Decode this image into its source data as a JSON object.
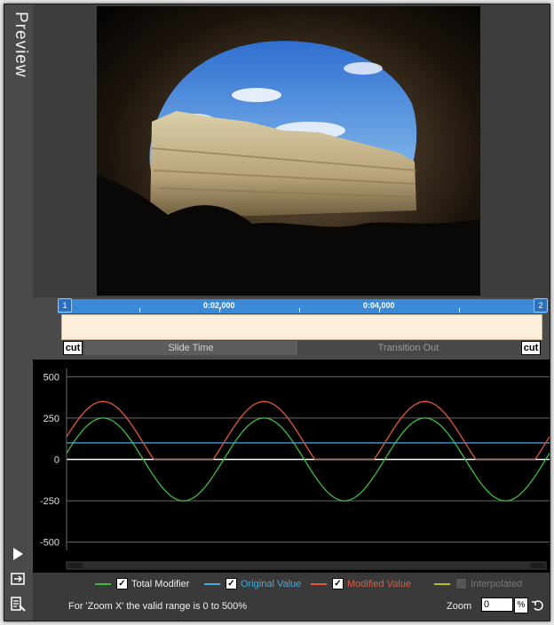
{
  "panel": {
    "title": "Preview"
  },
  "icons": {
    "play": "play-icon",
    "transition": "transition-icon",
    "edit": "edit-list-icon",
    "reset": "undo-icon"
  },
  "ruler": {
    "start_marker": "1",
    "end_marker": "2",
    "time_labels": [
      "0:02,000",
      "0:04,000"
    ],
    "cut_left": "cut",
    "cut_right": "cut",
    "segments": {
      "slide_time": "Slide Time",
      "transition_out": "Transition Out"
    }
  },
  "graph": {
    "y_ticks": [
      "500",
      "250",
      "0",
      "-250",
      "-500"
    ]
  },
  "chart_data": {
    "type": "line",
    "ylim": [
      -550,
      550
    ],
    "x_cycles": 3,
    "series": [
      {
        "name": "Total Modifier",
        "color": "#3fbf3f",
        "amplitude": 250,
        "offset": 0
      },
      {
        "name": "Original Value",
        "color": "#4aa8d8",
        "constant": 100
      },
      {
        "name": "Modified Value",
        "color": "#e05a3a",
        "amplitude": 250,
        "offset": 100,
        "floor": 0
      },
      {
        "name": "Interpolated",
        "color": "#b8c020"
      }
    ]
  },
  "legend": [
    {
      "label": "Total Modifier",
      "color": "#3fbf3f",
      "label_color": "#f0f0f0",
      "checked": true
    },
    {
      "label": "Original Value",
      "color": "#4aa8d8",
      "label_color": "#4aa8d8",
      "checked": true
    },
    {
      "label": "Modified Value",
      "color": "#e05a3a",
      "label_color": "#e05a3a",
      "checked": true
    },
    {
      "label": "Interpolated",
      "color": "#b8c020",
      "label_color": "#777777",
      "checked": false
    }
  ],
  "footer": {
    "hint": "For 'Zoom X' the valid range is 0 to 500%",
    "zoom_label": "Zoom",
    "zoom_value": "0",
    "zoom_unit": "%"
  }
}
